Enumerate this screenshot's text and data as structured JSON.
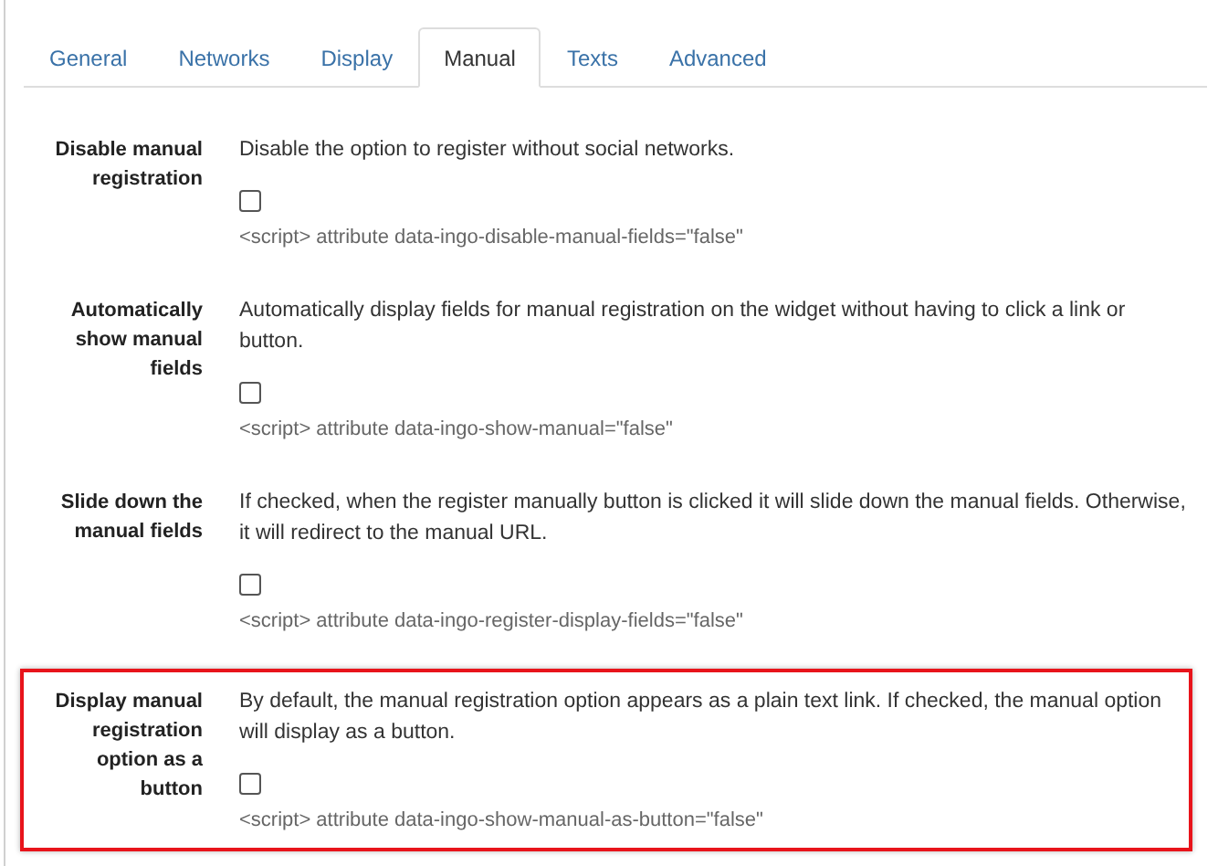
{
  "tabs": [
    {
      "label": "General",
      "selected": false
    },
    {
      "label": "Networks",
      "selected": false
    },
    {
      "label": "Display",
      "selected": false
    },
    {
      "label": "Manual",
      "selected": true
    },
    {
      "label": "Texts",
      "selected": false
    },
    {
      "label": "Advanced",
      "selected": false
    }
  ],
  "settings": [
    {
      "label": "Disable manual registration",
      "description": "Disable the option to register without social networks.",
      "checked": false,
      "attribute": "<script> attribute data-ingo-disable-manual-fields=\"false\"",
      "highlighted": false
    },
    {
      "label": "Automatically show manual fields",
      "description": "Automatically display fields for manual registration on the widget without having to click a link or button.",
      "checked": false,
      "attribute": "<script> attribute data-ingo-show-manual=\"false\"",
      "highlighted": false
    },
    {
      "label": "Slide down the manual fields",
      "description": "If checked, when the register manually button is clicked it will slide down the manual fields. Otherwise, it will redirect to the manual URL.",
      "checked": false,
      "attribute": "<script> attribute data-ingo-register-display-fields=\"false\"",
      "highlighted": false
    },
    {
      "label": "Display manual registration option as a button",
      "description": "By default, the manual registration option appears as a plain text link. If checked, the manual option will display as a button.",
      "checked": false,
      "attribute": "<script> attribute data-ingo-show-manual-as-button=\"false\"",
      "highlighted": true
    }
  ]
}
